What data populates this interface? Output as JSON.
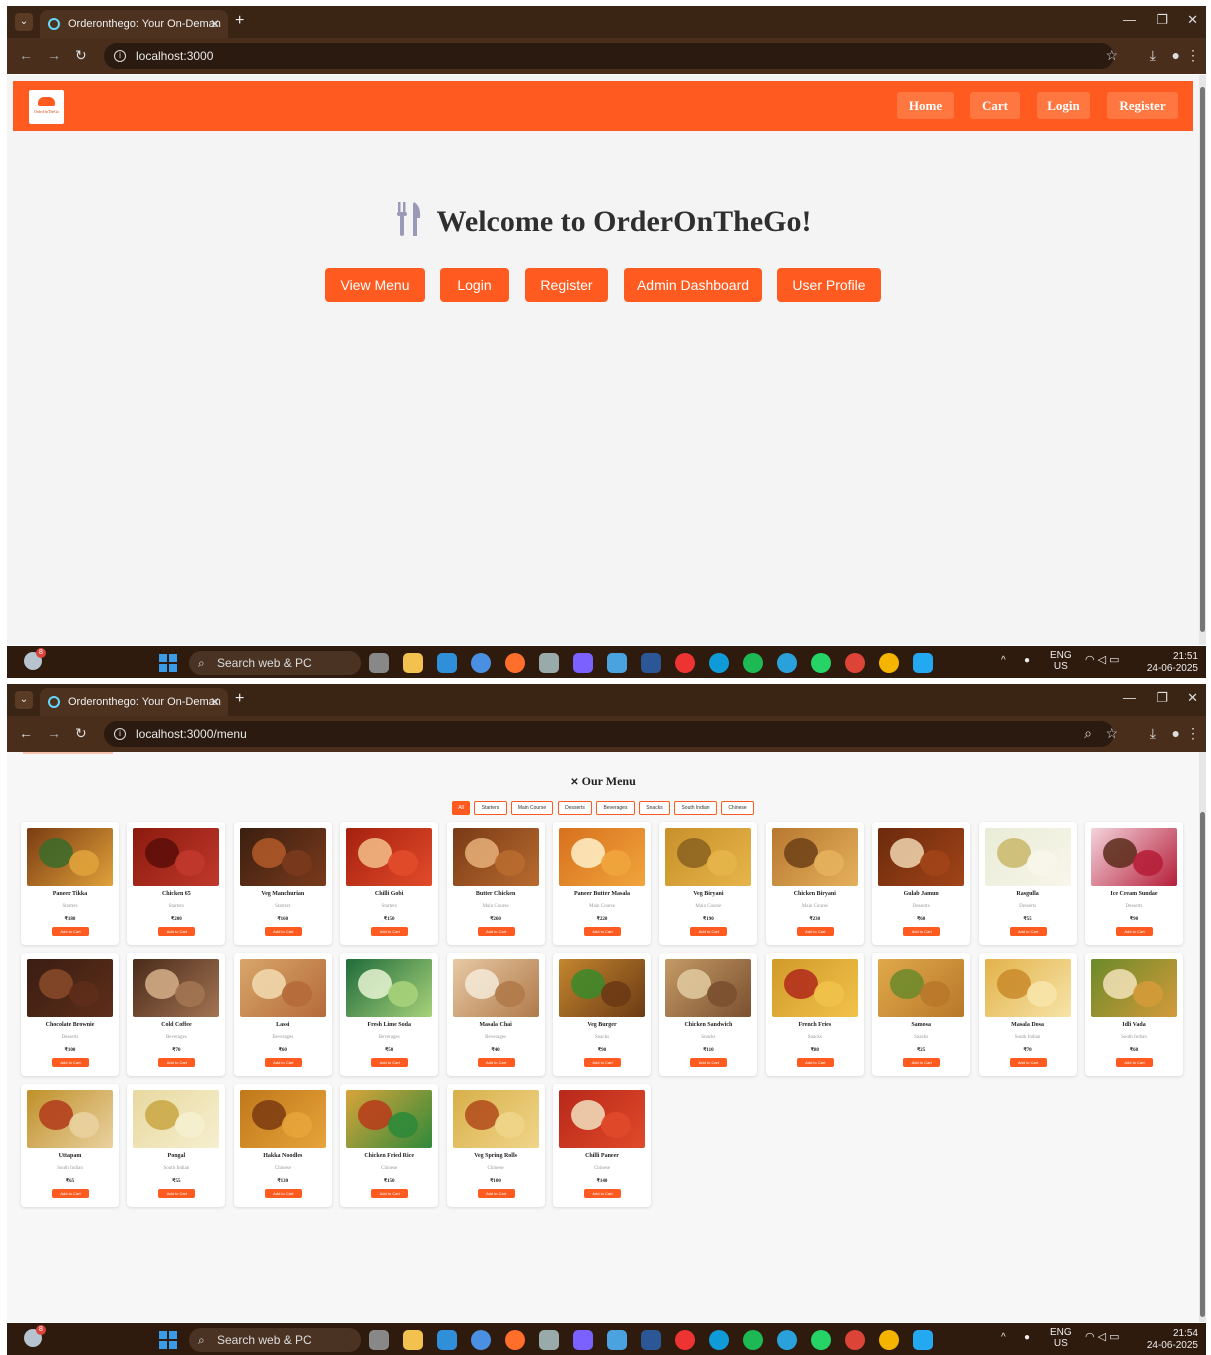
{
  "screens": [
    {
      "tab_title": "Orderonthego: Your On-Deman",
      "url": "localhost:3000",
      "taskbar": {
        "search": "Search web & PC",
        "lang1": "ENG",
        "lang2": "US",
        "time": "21:51",
        "date": "24-06-2025",
        "badge": "8"
      }
    },
    {
      "tab_title": "Orderonthego: Your On-Deman",
      "url": "localhost:3000/menu",
      "taskbar": {
        "search": "Search web & PC",
        "lang1": "ENG",
        "lang2": "US",
        "time": "21:54",
        "date": "24-06-2025",
        "badge": "8"
      }
    }
  ],
  "app": {
    "brand_colors": {
      "primary": "#ff5a1f",
      "nav_button": "#ff7740"
    },
    "logo_text": "OrderOnTheGo",
    "nav": [
      "Home",
      "Cart",
      "Login",
      "Register"
    ],
    "home": {
      "title": "Welcome to OrderOnTheGo!",
      "title_icon": "fork-knife-icon",
      "buttons": [
        "View Menu",
        "Login",
        "Register",
        "Admin Dashboard",
        "User Profile"
      ]
    },
    "menu": {
      "title": "Our Menu",
      "title_icon": "utensils-icon",
      "filters": [
        "All",
        "Starters",
        "Main Course",
        "Desserts",
        "Beverages",
        "Snacks",
        "South Indian",
        "Chinese"
      ],
      "active_filter": "All",
      "add_label": "Add to Cart",
      "items": [
        {
          "name": "Paneer Tikka",
          "category": "Starters",
          "price": "₹180"
        },
        {
          "name": "Chicken 65",
          "category": "Starters",
          "price": "₹200"
        },
        {
          "name": "Veg Manchurian",
          "category": "Starters",
          "price": "₹160"
        },
        {
          "name": "Chilli Gobi",
          "category": "Starters",
          "price": "₹150"
        },
        {
          "name": "Butter Chicken",
          "category": "Main Course",
          "price": "₹260"
        },
        {
          "name": "Paneer Butter Masala",
          "category": "Main Course",
          "price": "₹220"
        },
        {
          "name": "Veg Biryani",
          "category": "Main Course",
          "price": "₹190"
        },
        {
          "name": "Chicken Biryani",
          "category": "Main Course",
          "price": "₹230"
        },
        {
          "name": "Gulab Jamun",
          "category": "Desserts",
          "price": "₹60"
        },
        {
          "name": "Rasgulla",
          "category": "Desserts",
          "price": "₹55"
        },
        {
          "name": "Ice Cream Sundae",
          "category": "Desserts",
          "price": "₹90"
        },
        {
          "name": "Chocolate Brownie",
          "category": "Desserts",
          "price": "₹100"
        },
        {
          "name": "Cold Coffee",
          "category": "Beverages",
          "price": "₹70"
        },
        {
          "name": "Lassi",
          "category": "Beverages",
          "price": "₹60"
        },
        {
          "name": "Fresh Lime Soda",
          "category": "Beverages",
          "price": "₹50"
        },
        {
          "name": "Masala Chai",
          "category": "Beverages",
          "price": "₹40"
        },
        {
          "name": "Veg Burger",
          "category": "Snacks",
          "price": "₹90"
        },
        {
          "name": "Chicken Sandwich",
          "category": "Snacks",
          "price": "₹110"
        },
        {
          "name": "French Fries",
          "category": "Snacks",
          "price": "₹80"
        },
        {
          "name": "Samosa",
          "category": "Snacks",
          "price": "₹25"
        },
        {
          "name": "Masala Dosa",
          "category": "South Indian",
          "price": "₹70"
        },
        {
          "name": "Idli Vada",
          "category": "South Indian",
          "price": "₹60"
        },
        {
          "name": "Uttapam",
          "category": "South Indian",
          "price": "₹65"
        },
        {
          "name": "Pongal",
          "category": "South Indian",
          "price": "₹55"
        },
        {
          "name": "Hakka Noodles",
          "category": "Chinese",
          "price": "₹130"
        },
        {
          "name": "Chicken Fried Rice",
          "category": "Chinese",
          "price": "₹150"
        },
        {
          "name": "Veg Spring Rolls",
          "category": "Chinese",
          "price": "₹100"
        },
        {
          "name": "Chilli Paneer",
          "category": "Chinese",
          "price": "₹140"
        }
      ]
    }
  }
}
